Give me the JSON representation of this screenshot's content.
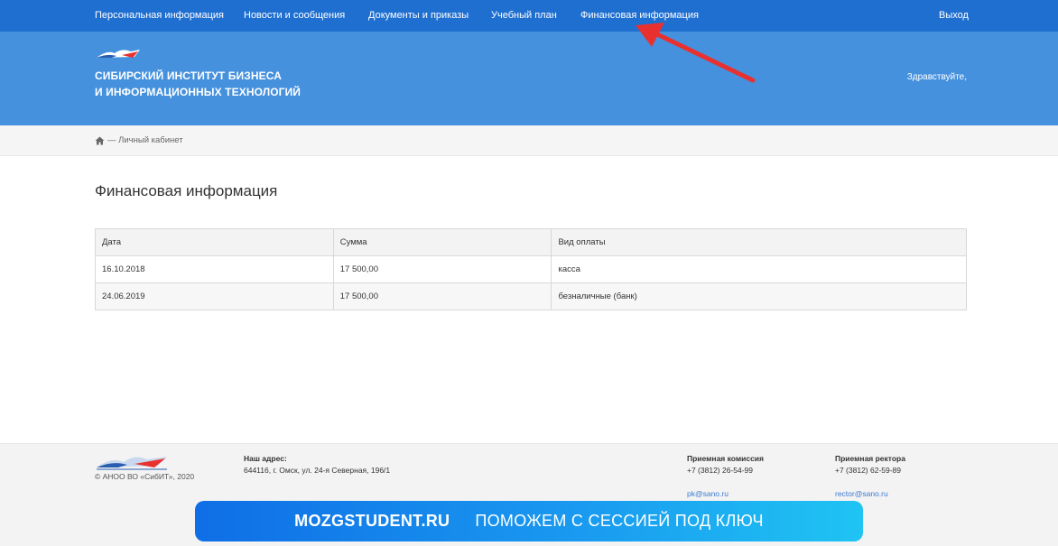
{
  "nav": {
    "items": [
      {
        "label": "Персональная информация"
      },
      {
        "label": "Новости и сообщения"
      },
      {
        "label": "Документы и приказы"
      },
      {
        "label": "Учебный план"
      },
      {
        "label": "Финансовая информация"
      }
    ],
    "logout": "Выход"
  },
  "header": {
    "brand_line1": "СИБИРСКИЙ ИНСТИТУТ БИЗНЕСА",
    "brand_line2": "И ИНФОРМАЦИОННЫХ ТЕХНОЛОГИЙ",
    "greeting": "Здравствуйте,"
  },
  "breadcrumb": {
    "text": "— Личный кабинет"
  },
  "page": {
    "title": "Финансовая информация"
  },
  "table": {
    "headers": [
      "Дата",
      "Сумма",
      "Вид оплаты"
    ],
    "rows": [
      [
        "16.10.2018",
        "17 500,00",
        "касса"
      ],
      [
        "24.06.2019",
        "17 500,00",
        "безналичные (банк)"
      ]
    ]
  },
  "footer": {
    "copyright": "© АНОО ВО «СибИТ», 2020",
    "address_label": "Наш адрес:",
    "address": "644116, г. Омск, ул. 24-я Северная, 196/1",
    "admission_label": "Приемная комиссия",
    "admission_phone": "+7 (3812) 26-54-99",
    "admission_email": "pk@sano.ru",
    "rector_label": "Приемная ректора",
    "rector_phone": "+7 (3812) 62-59-89",
    "rector_email": "rector@sano.ru"
  },
  "promo": {
    "site": "MOZGSTUDENT.RU",
    "slogan": "ПОМОЖЕМ С СЕССИЕЙ ПОД КЛЮЧ"
  },
  "colors": {
    "nav_bg": "#1f6fd1",
    "header_bg": "#4591de",
    "arrow": "#e8312f"
  }
}
